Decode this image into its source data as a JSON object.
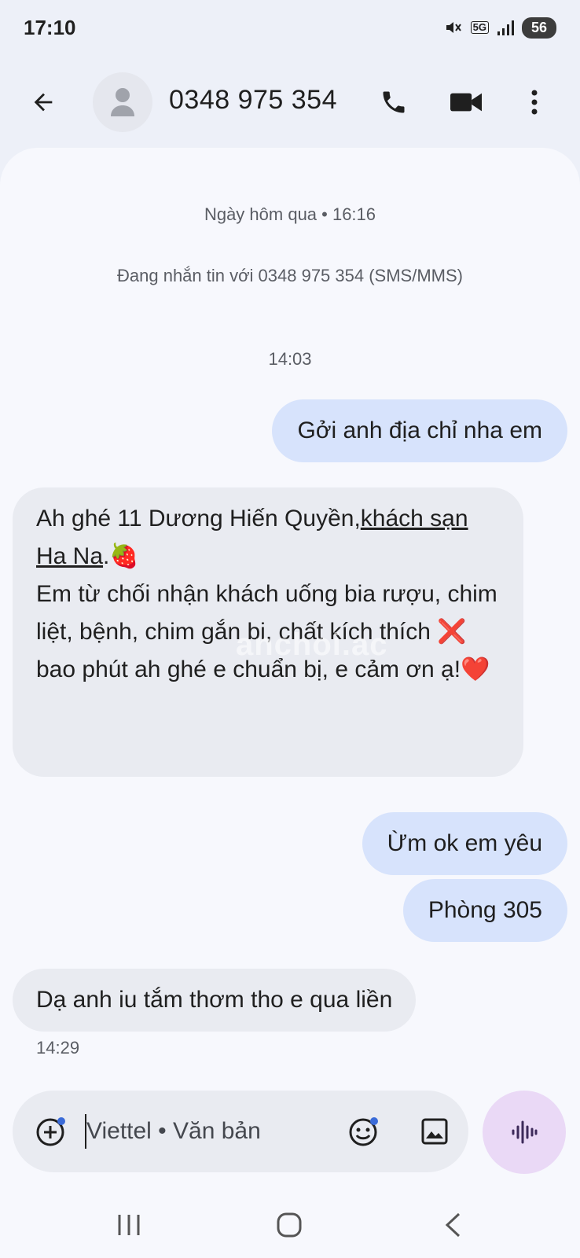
{
  "status_bar": {
    "time": "17:10",
    "network_label": "5G",
    "battery": "56",
    "icons": [
      "mute-icon",
      "5g-icon",
      "signal-icon",
      "battery-icon"
    ]
  },
  "header": {
    "contact": "0348 975 354",
    "icons": [
      "back-arrow-icon",
      "person-icon",
      "phone-icon",
      "video-camera-icon",
      "more-vertical-icon"
    ]
  },
  "conversation": {
    "date_divider": "Ngày hôm qua • 16:16",
    "info": "Đang nhắn tin với 0348 975 354 (SMS/MMS)",
    "time_label_1": "14:03",
    "messages": [
      {
        "direction": "outgoing",
        "text": "Gởi anh địa chỉ nha em"
      },
      {
        "direction": "incoming",
        "text_prefix": "Ah ghé 11 Dương Hiến Quyền,",
        "link_text": "khách sạn Ha Na",
        "text_rest": ".🍓\n Em từ chối nhận khách uống bia rượu, chim liệt, bệnh, chim gắn bi, chất kích thích ❌\n bao phút ah ghé e chuẩn bị, e cảm ơn ạ!❤️"
      },
      {
        "direction": "outgoing",
        "text": "Ừm ok em yêu"
      },
      {
        "direction": "outgoing",
        "text": "Phòng 305"
      },
      {
        "direction": "incoming",
        "text": "Dạ anh iu tắm thơm tho e qua liền"
      }
    ],
    "time_label_2": "14:29",
    "watermark": "anchoi.ac"
  },
  "compose": {
    "placeholder": "Viettel • Văn bản",
    "icons": [
      "add-circle-icon",
      "emoji-icon",
      "image-icon",
      "voice-waveform-icon"
    ]
  },
  "nav_bar": {
    "icons": [
      "recent-apps-icon",
      "home-icon",
      "nav-back-icon"
    ]
  },
  "colors": {
    "background": "#edf0f8",
    "outgoing_bubble": "#d7e3fc",
    "incoming_bubble": "#e9ebf1",
    "voice_button": "#ead9f6"
  }
}
